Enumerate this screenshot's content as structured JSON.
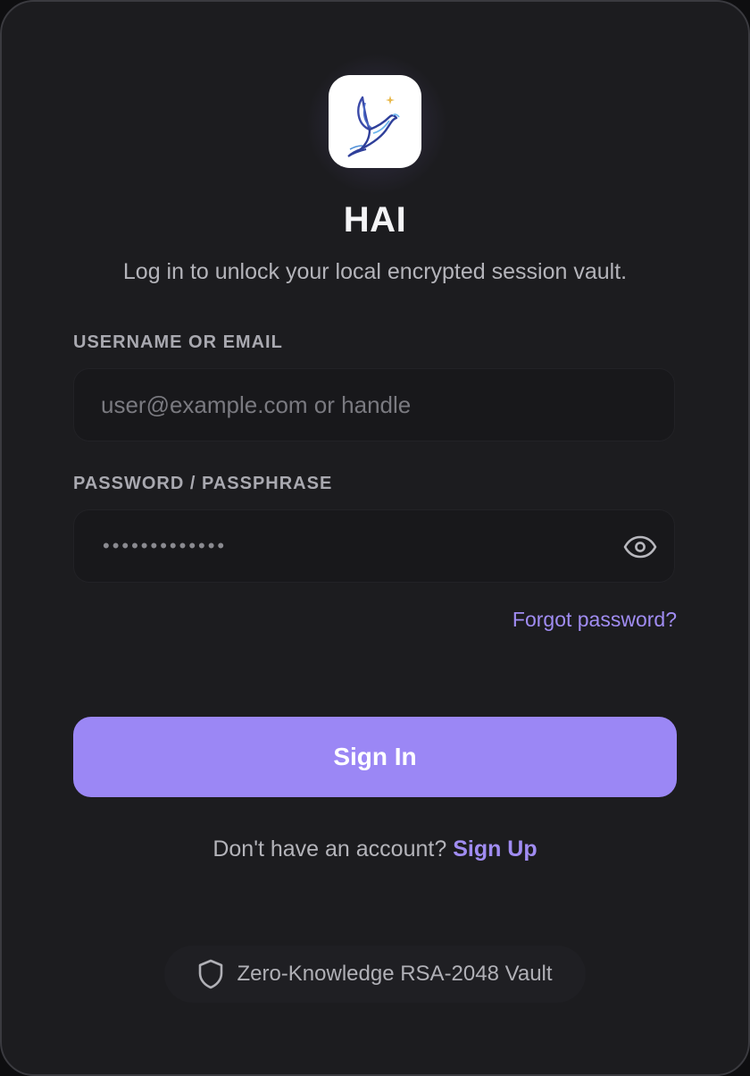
{
  "app": {
    "title": "HAI",
    "subtitle": "Log in to unlock your local encrypted session vault."
  },
  "username_field": {
    "label": "USERNAME OR EMAIL",
    "placeholder": "user@example.com or handle",
    "value": ""
  },
  "password_field": {
    "label": "PASSWORD / PASSPHRASE",
    "masked_value": "•••••••••••••",
    "toggle_icon": "eye-icon"
  },
  "forgot_password": "Forgot password?",
  "sign_in_button": "Sign In",
  "signup": {
    "prompt": "Don't have an account?",
    "link": "Sign Up"
  },
  "vault_badge": {
    "icon": "shield-icon",
    "text": "Zero-Knowledge RSA-2048 Vault"
  },
  "colors": {
    "accent": "#9b87f5",
    "link": "#a08cf2",
    "card_background": "#1c1c1f",
    "input_background": "#18181b"
  },
  "logo": {
    "icon": "bird-logo-icon"
  }
}
